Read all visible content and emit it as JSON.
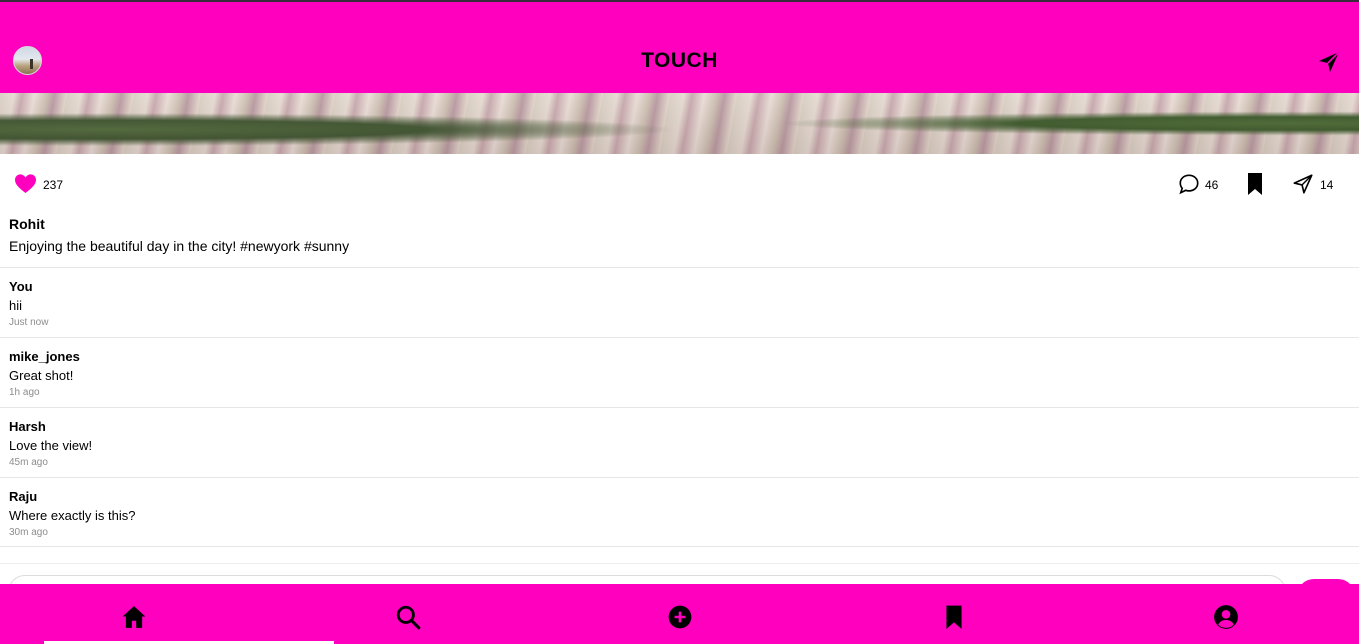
{
  "header": {
    "title": "TOUCH",
    "avatar_icon": "user-avatar",
    "direct_icon": "paper-plane-icon",
    "background_color": "#ff00bf"
  },
  "post": {
    "likes": "237",
    "comments_count": "46",
    "shares": "14",
    "author": "Rohit",
    "caption": "Enjoying the beautiful day in the city! #newyork #sunny",
    "like_color": "#ff00bf"
  },
  "comments": [
    {
      "user": "You",
      "text": "hii",
      "time": "Just now"
    },
    {
      "user": "mike_jones",
      "text": "Great shot!",
      "time": "1h ago"
    },
    {
      "user": "Harsh",
      "text": "Love the view!",
      "time": "45m ago"
    },
    {
      "user": "Raju",
      "text": "Where exactly is this?",
      "time": "30m ago"
    }
  ],
  "comment_form": {
    "value": ""
  },
  "bottom_nav": {
    "items": [
      "home-icon",
      "search-icon",
      "add-icon",
      "bookmark-icon",
      "profile-icon"
    ],
    "active": "home-icon"
  }
}
